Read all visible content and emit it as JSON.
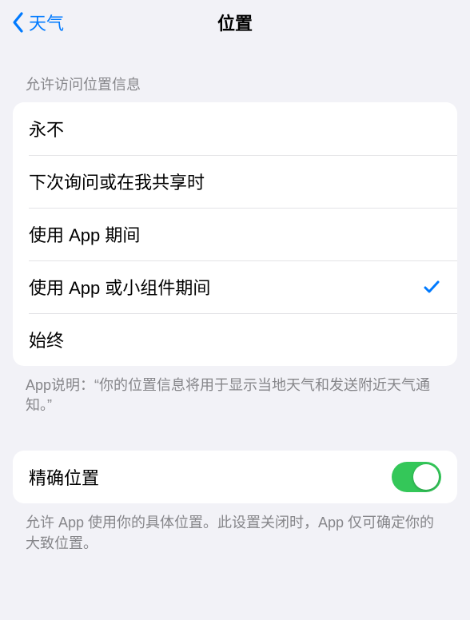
{
  "nav": {
    "back_label": "天气",
    "title": "位置"
  },
  "location_access": {
    "header": "允许访问位置信息",
    "options": [
      {
        "label": "永不",
        "selected": false
      },
      {
        "label": "下次询问或在我共享时",
        "selected": false
      },
      {
        "label": "使用 App 期间",
        "selected": false
      },
      {
        "label": "使用 App 或小组件期间",
        "selected": true
      },
      {
        "label": "始终",
        "selected": false
      }
    ],
    "footer": "App说明：“你的位置信息将用于显示当地天气和发送附近天气通知。”"
  },
  "precise": {
    "label": "精确位置",
    "on": true,
    "footer": "允许 App 使用你的具体位置。此设置关闭时，App 仅可确定你的大致位置。"
  }
}
